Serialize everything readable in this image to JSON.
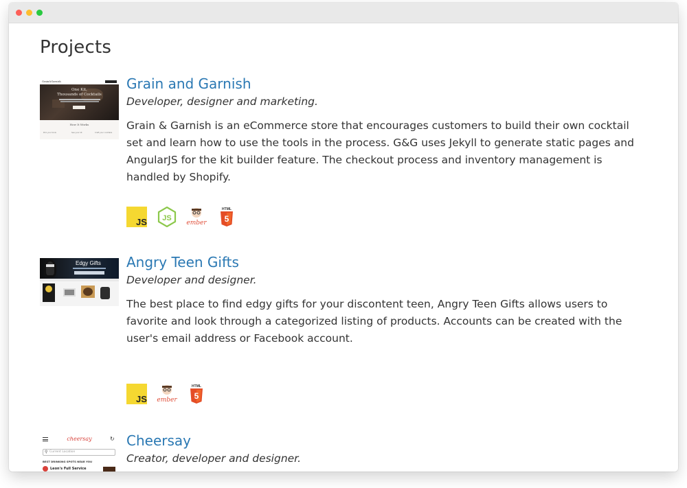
{
  "page": {
    "title": "Projects"
  },
  "projects": [
    {
      "title": "Grain and Garnish",
      "role": "Developer, designer and marketing.",
      "description": "Grain & Garnish is an eCommerce store that encourages customers to build their own cocktail set and learn how to use the tools in the process. G&G uses Jekyll to generate static pages and AngularJS for the kit builder feature. The checkout process and inventory management is handled by Shopify.",
      "thumbnail_text": {
        "logo": "Grain&Garnish",
        "headline1": "One Kit,",
        "headline2": "Thousands of Cocktails",
        "section": "How It Works",
        "step1": "Pick your tools",
        "step2": "See your kit",
        "step3": "Craft your cocktails"
      },
      "technologies": [
        "javascript-icon",
        "nodejs-icon",
        "ember-icon",
        "html5-icon"
      ]
    },
    {
      "title": "Angry Teen Gifts",
      "role": "Developer and designer.",
      "description": "The best place to find edgy gifts for your discontent teen, Angry Teen Gifts allows users to favorite and look through a categorized listing of products. Accounts can be created with the user's email address or Facebook account.",
      "thumbnail_text": {
        "headline": "Edgy Gifts"
      },
      "technologies": [
        "javascript-icon",
        "ember-icon",
        "html5-icon"
      ]
    },
    {
      "title": "Cheersay",
      "role": "Creator, developer and designer.",
      "thumbnail_text": {
        "logo": "cheersay",
        "search_placeholder": "Current Location",
        "section": "BEST DRINKING SPOTS NEAR YOU",
        "item": "Leon's Full Service"
      }
    }
  ],
  "tech_labels": {
    "js": "JS",
    "html": "HTML",
    "five": "5",
    "ember": "ember"
  },
  "colors": {
    "link": "#2a78b3",
    "js_yellow": "#f5d831",
    "node_green": "#8cc84b",
    "html_orange": "#e44d26",
    "ember_red": "#e04e39"
  }
}
